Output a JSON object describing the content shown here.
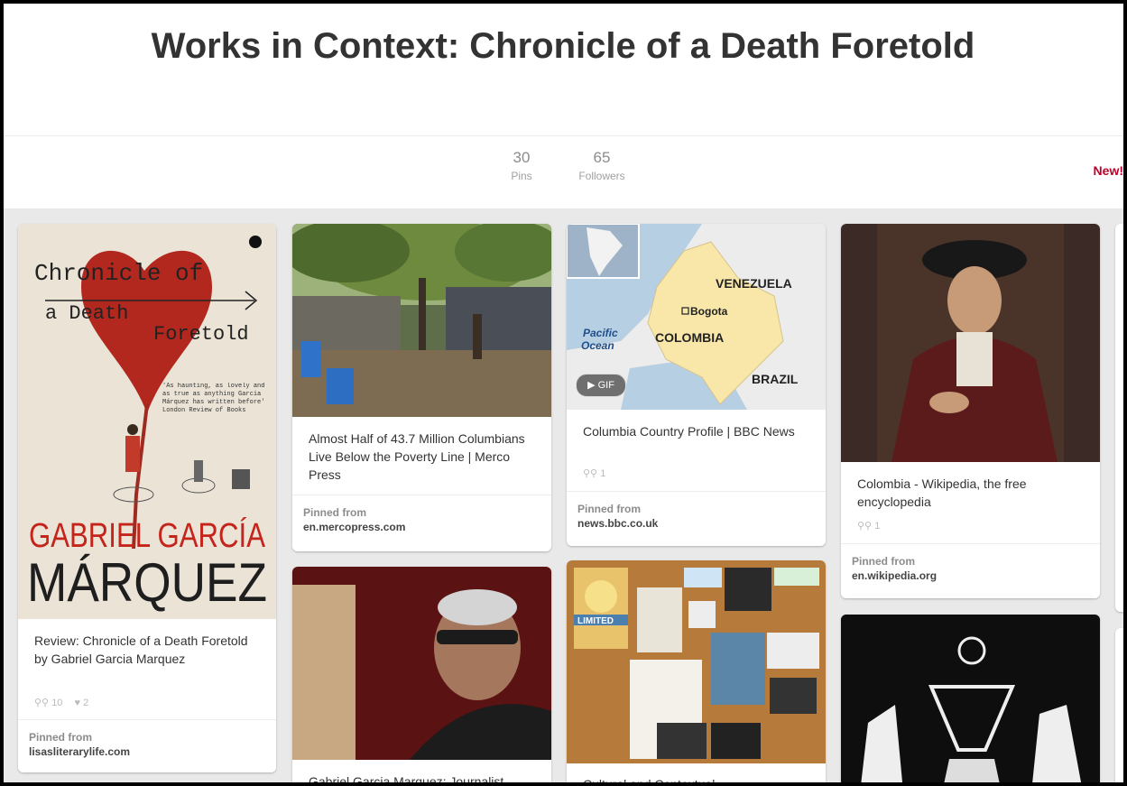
{
  "board": {
    "title": "Works in Context: Chronicle of a Death Foretold"
  },
  "stats": {
    "pins_count": "30",
    "pins_label": "Pins",
    "followers_count": "65",
    "followers_label": "Followers",
    "new_label": "New!"
  },
  "pins": [
    {
      "description": "Review: Chronicle of a Death Foretold by Gabriel Garcia Marquez",
      "repins": "10",
      "likes": "2",
      "source_label": "Pinned from",
      "source_domain": "lisasliterarylife.com",
      "cover": {
        "title_line1": "Chronicle of",
        "title_line2": "a Death",
        "title_line3": "Foretold",
        "quote": "'As haunting, as lovely and as true as anything Garcia Márquez has written before' London Review of Books",
        "author_line1": "GABRIEL GARCÍA",
        "author_line2": "MÁRQUEZ"
      }
    },
    {
      "description": "Almost Half of 43.7 Million Columbians Live Below the Poverty Line | Merco Press",
      "source_label": "Pinned from",
      "source_domain": "en.mercopress.com"
    },
    {
      "description": "Columbia Country Profile | BBC News",
      "repins": "1",
      "source_label": "Pinned from",
      "source_domain": "news.bbc.co.uk",
      "map": {
        "venezuela": "VENEZUELA",
        "bogota": "Bogota",
        "colombia": "COLOMBIA",
        "ocean_line1": "Pacific",
        "ocean_line2": "Ocean",
        "brazil": "BRAZIL",
        "gif": "GIF"
      }
    },
    {
      "description": "Colombia - Wikipedia, the free encyclopedia",
      "repins": "1",
      "source_label": "Pinned from",
      "source_domain": "en.wikipedia.org"
    },
    {
      "description": "Gabriel Garcia Marquez: Journalist,"
    },
    {
      "description": "Cultural and Contextual",
      "collage_label": "LIMITED"
    }
  ],
  "colors": {
    "accent_red": "#b9002a",
    "board_bg": "#e9e9e9",
    "cover_red": "#b2281e",
    "colombia_yellow": "#f8e7a9",
    "ocean_blue": "#b7cfe3"
  }
}
